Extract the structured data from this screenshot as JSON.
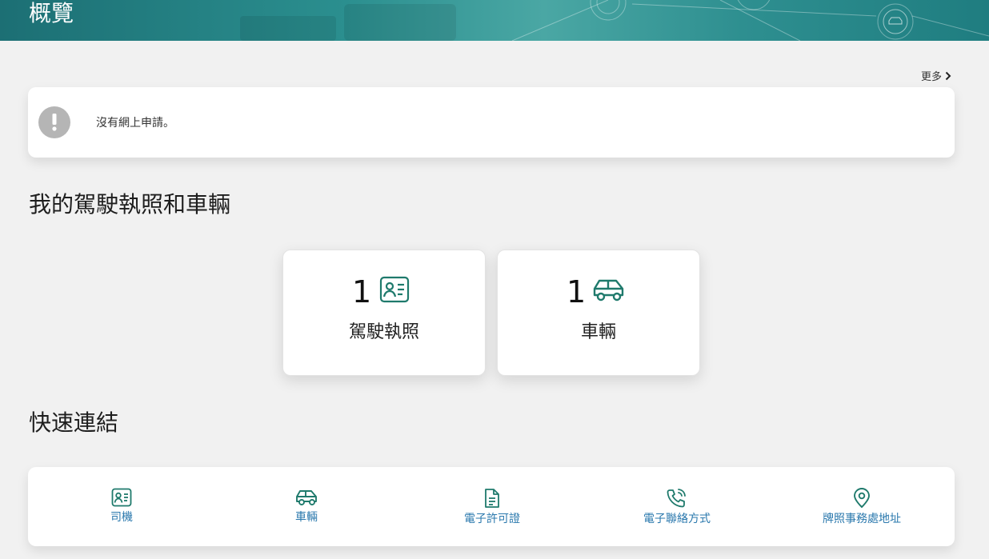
{
  "header": {
    "title": "概覽"
  },
  "applications": {
    "more_label": "更多",
    "empty_message": "沒有網上申請。"
  },
  "licenses_section": {
    "title": "我的駕駛執照和車輛",
    "cards": [
      {
        "count": "1",
        "label": "駕駛執照",
        "icon": "id-card-icon"
      },
      {
        "count": "1",
        "label": "車輛",
        "icon": "car-icon"
      }
    ]
  },
  "quick_links": {
    "title": "快速連結",
    "items": [
      {
        "label": "司機",
        "icon": "id-card-icon"
      },
      {
        "label": "車輛",
        "icon": "car-icon"
      },
      {
        "label": "電子許可證",
        "icon": "document-icon"
      },
      {
        "label": "電子聯絡方式",
        "icon": "phone-icon"
      },
      {
        "label": "牌照事務處地址",
        "icon": "location-pin-icon"
      }
    ]
  },
  "colors": {
    "accent": "#1f7a6c",
    "link": "#2a78ad",
    "banner": "#2b8f8f",
    "notice_icon": "#b5b5b5"
  }
}
